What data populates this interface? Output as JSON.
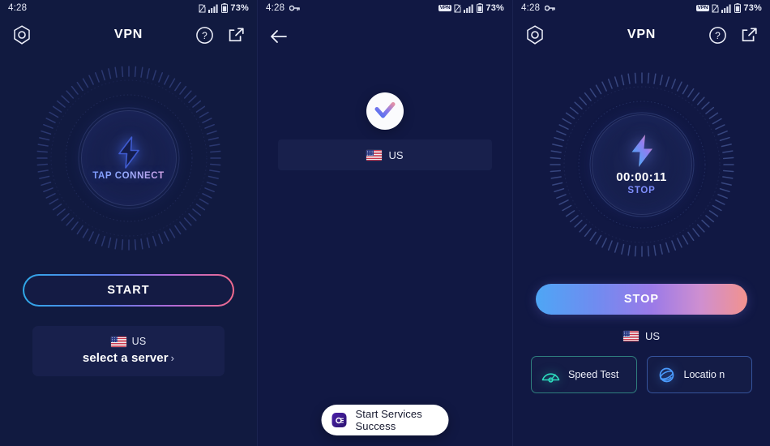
{
  "status_bar": {
    "time": "4:28",
    "battery_percent": "73%",
    "vpn_badge": "VPN",
    "key_icon": "key-icon",
    "sim_icon": "no-sim-icon",
    "signal_icon": "signal-bars-icon",
    "battery_icon": "battery-icon"
  },
  "colors": {
    "background": "#111843",
    "card": "#18204c",
    "accent_blue": "#4ea6f5",
    "accent_purple": "#9b7ae8",
    "accent_pink": "#f2928e",
    "speed_green": "#2ddcbe",
    "location_blue": "#4a9bff",
    "stop_text": "#7e8dfb"
  },
  "screen_disconnected": {
    "nav": {
      "settings_icon": "hexagon-settings-icon",
      "title": "VPN",
      "help_icon": "question-circle-icon",
      "share_icon": "share-icon"
    },
    "dial": {
      "bolt_icon": "lightning-bolt-icon",
      "label": "TAP CONNECT"
    },
    "start_button": "START",
    "server_card": {
      "flag_icon": "us-flag-icon",
      "country_code": "US",
      "select_label": "select a server",
      "chevron": "›"
    }
  },
  "screen_connecting": {
    "nav": {
      "back_icon": "back-arrow-icon"
    },
    "check_icon": "check-mark-icon",
    "selected_country": {
      "flag_icon": "us-flag-icon",
      "country_code": "US"
    },
    "toast": {
      "app_icon": "app-icon",
      "message": "Start Services Success"
    }
  },
  "screen_connected": {
    "nav": {
      "settings_icon": "hexagon-settings-icon",
      "title": "VPN",
      "help_icon": "question-circle-icon",
      "share_icon": "share-icon"
    },
    "dial": {
      "bolt_icon": "lightning-bolt-icon",
      "timer": "00:00:11",
      "state_label": "STOP"
    },
    "stop_button": "STOP",
    "active_country": {
      "flag_icon": "us-flag-icon",
      "country_code": "US"
    },
    "tools": [
      {
        "icon": "speedometer-icon",
        "label": "Speed Test"
      },
      {
        "icon": "globe-icon",
        "label": "Locatio n"
      }
    ]
  }
}
